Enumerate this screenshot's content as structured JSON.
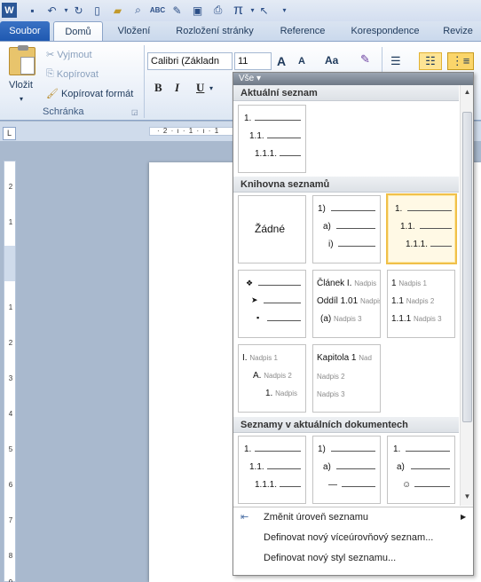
{
  "quick_access": {
    "icons": [
      "word-icon",
      "save-icon",
      "undo-icon",
      "dropdown-icon",
      "repeat-icon",
      "new-icon",
      "open-icon",
      "print-preview-icon",
      "spelling-icon",
      "edit-icon",
      "picture-icon",
      "print-icon",
      "pi-icon",
      "dropdown-icon",
      "pointer-icon",
      "customize-icon"
    ],
    "spelling_label": "ABC"
  },
  "tabs": [
    "Soubor",
    "Domů",
    "Vložení",
    "Rozložení stránky",
    "Reference",
    "Korespondence",
    "Revize"
  ],
  "clipboard": {
    "paste_label": "Vložit",
    "cut_label": "Vyjmout",
    "copy_label": "Kopírovat",
    "format_painter_label": "Kopírovat formát",
    "group_label": "Schránka"
  },
  "font": {
    "font_name": "Calibri (Základn",
    "font_size": "11",
    "grow_label": "A",
    "shrink_label": "A",
    "case_label": "Aa",
    "bold": "B",
    "italic": "I",
    "underline": "U"
  },
  "gallery": {
    "filter_label": "Vše ▾",
    "sections": {
      "current": "Aktuální seznam",
      "library": "Knihovna seznamů",
      "documents": "Seznamy v aktuálních dokumentech"
    },
    "current_list": [
      "1.",
      "1.1.",
      "1.1.1."
    ],
    "none_label": "Žádné",
    "library_lists": {
      "paren": [
        "1)",
        "a)",
        "i)"
      ],
      "decimal": [
        "1.",
        "1.1.",
        "1.1.1."
      ],
      "symbols": [
        "❖",
        "➤",
        "▪"
      ],
      "article": [
        [
          "Článek I.",
          "Nadpis"
        ],
        [
          "Oddíl 1.01",
          "Nadpis"
        ],
        [
          "(a)",
          "Nadpis 3"
        ]
      ],
      "heading_nums": [
        [
          "1",
          "Nadpis 1"
        ],
        [
          "1.1",
          "Nadpis 2"
        ],
        [
          "1.1.1",
          "Nadpis 3"
        ]
      ],
      "roman": [
        [
          "I.",
          "Nadpis 1"
        ],
        [
          "A.",
          "Nadpis 2"
        ],
        [
          "1.",
          "Nadpis"
        ]
      ],
      "chapter": [
        [
          "Kapitola 1",
          "Nad"
        ],
        [
          "",
          "Nadpis 2"
        ],
        [
          "",
          "Nadpis 3"
        ]
      ]
    },
    "doc_lists": {
      "d1": [
        "1.",
        "1.1.",
        "1.1.1."
      ],
      "d2": [
        "1)",
        "a)",
        "—"
      ],
      "d3": [
        "1.",
        "a)",
        "☺"
      ]
    },
    "menu": {
      "change_level": "Změnit úroveň seznamu",
      "define_multilevel": "Definovat nový víceúrovňový seznam...",
      "define_style": "Definovat nový styl seznamu..."
    }
  },
  "ruler": {
    "h_ticks": [
      "2",
      "1",
      "1"
    ],
    "v_ticks": [
      "2",
      "1",
      "1",
      "2",
      "3",
      "4",
      "5",
      "6",
      "7",
      "8",
      "9"
    ],
    "corner_label": "L"
  },
  "colors": {
    "file_tab": "#1e58b0",
    "selection": "#f0c049"
  }
}
